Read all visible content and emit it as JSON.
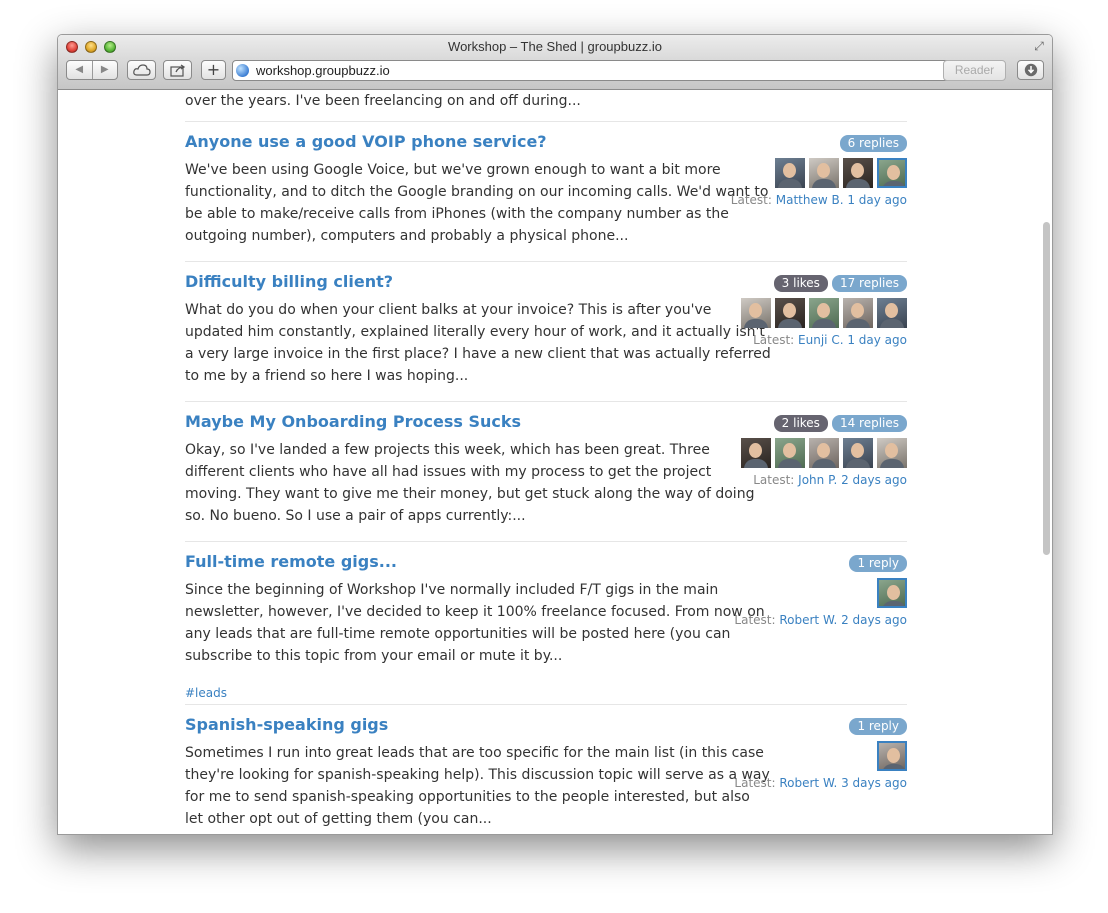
{
  "window": {
    "title": "Workshop – The Shed | groupbuzz.io",
    "url": "workshop.groupbuzz.io",
    "reader_label": "Reader"
  },
  "top_snippet": "over the years. I've been freelancing on and off during...",
  "latest_label": "Latest:",
  "topics": [
    {
      "title": "Anyone use a good VOIP phone service?",
      "lines": [
        "We've been using Google Voice, but we've grown enough to want a bit more",
        "functionality, and to ditch the Google branding on our incoming calls. We'd want to",
        "be able to make/receive calls from iPhones (with the company number as the",
        "outgoing number), computers and probably a physical phone..."
      ],
      "likes": "",
      "replies": "6 replies",
      "avatar_count": 4,
      "latest_user": "Matthew B.",
      "latest_time": "1 day ago",
      "tag": ""
    },
    {
      "title": "Difficulty billing client?",
      "lines": [
        "What do you do when your client balks at your invoice? This is after you've",
        "updated him constantly, explained literally every hour of work, and it actually isn't",
        "a very large invoice in the first place? I have a new client that was actually referred",
        "to me by a friend so here I was hoping..."
      ],
      "likes": "3 likes",
      "replies": "17 replies",
      "avatar_count": 5,
      "latest_user": "Eunji C.",
      "latest_time": "1 day ago",
      "tag": ""
    },
    {
      "title": "Maybe My Onboarding Process Sucks",
      "lines": [
        "Okay, so I've landed a few projects this week, which has been great. Three",
        "different clients who have all had issues with my process to get the project",
        "moving. They want to give me their money, but get stuck along the way of doing",
        "so. No bueno. So I use a pair of apps currently:..."
      ],
      "likes": "2 likes",
      "replies": "14 replies",
      "avatar_count": 5,
      "latest_user": "John P.",
      "latest_time": "2 days ago",
      "tag": ""
    },
    {
      "title": "Full-time remote gigs...",
      "lines": [
        "Since the beginning of Workshop I've normally included F/T gigs in the main",
        "newsletter, however, I've decided to keep it 100% freelance focused. From now on",
        "any leads that are full-time remote opportunities will be posted here (you can",
        "subscribe to this topic from your email or mute it by..."
      ],
      "likes": "",
      "replies": "1 reply",
      "avatar_count": 1,
      "latest_user": "Robert W.",
      "latest_time": "2 days ago",
      "tag": "#leads"
    },
    {
      "title": "Spanish-speaking gigs",
      "lines": [
        "Sometimes I run into great leads that are too specific for the main list (in this case",
        "they're looking for spanish-speaking help). This discussion topic will serve as a way",
        "for me to send spanish-speaking opportunities to the people interested, but also",
        "let other opt out of getting them (you can..."
      ],
      "likes": "",
      "replies": "1 reply",
      "avatar_count": 1,
      "latest_user": "Robert W.",
      "latest_time": "3 days ago",
      "tag": ""
    }
  ]
}
